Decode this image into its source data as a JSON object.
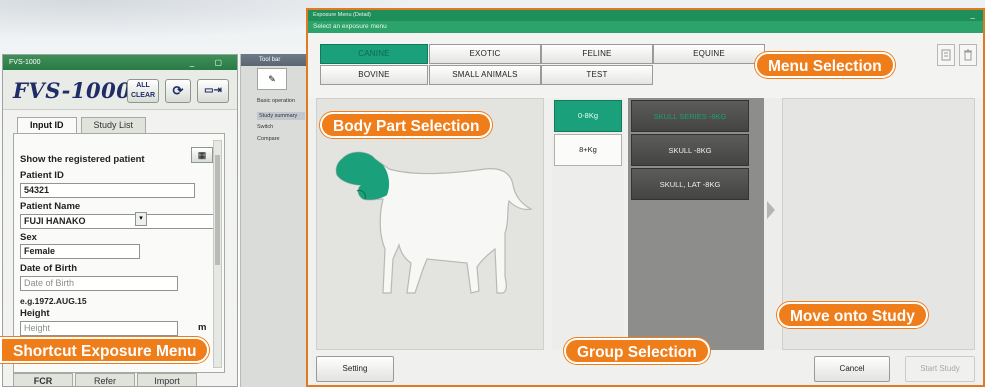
{
  "small_window": {
    "title": "FVS-1000",
    "logo": "FVS-1000",
    "all_clear": "ALL\nCLEAR",
    "tabs": [
      {
        "label": "Input ID"
      },
      {
        "label": "Study List"
      }
    ],
    "heading": "Show the registered patient",
    "patient_id_label": "Patient ID",
    "patient_id_value": "54321",
    "patient_name_label": "Patient Name",
    "patient_name_value": "FUJI HANAKO",
    "sex_label": "Sex",
    "sex_value": "Female",
    "dob_label": "Date of Birth",
    "dob_placeholder": "Date of Birth",
    "dob_example": "e.g.1972.AUG.15",
    "height_label": "Height",
    "height_placeholder": "Height",
    "height_unit": "m",
    "bottom_tabs": [
      "FCR",
      "Refer",
      "Import"
    ]
  },
  "mid_strip": {
    "header": "Tool bar",
    "lines": [
      "Basic operation",
      "Study summary",
      "Switch",
      "Compare"
    ]
  },
  "main_window": {
    "title": "Exposure Menu (Detail)",
    "subtitle": "Select an exposure menu",
    "menu_row1": [
      "CANINE",
      "EXOTIC",
      "FELINE",
      "EQUINE"
    ],
    "menu_row2": [
      "BOVINE",
      "SMALL ANIMALS",
      "TEST"
    ],
    "groups": [
      "0-8Kg",
      "8+Kg"
    ],
    "exposures": [
      "SKULL SERIES -8KG",
      "SKULL -8KG",
      "SKULL, LAT -8KG"
    ],
    "setting_label": "Setting",
    "cancel_label": "Cancel",
    "start_label": "Start Study",
    "accent_color": "#1aa07a"
  },
  "callouts": {
    "menu_selection": "Menu Selection",
    "body_part_selection": "Body Part Selection",
    "group_selection": "Group Selection",
    "move_onto_study": "Move onto Study",
    "shortcut_exposure_menu": "Shortcut Exposure Menu"
  }
}
